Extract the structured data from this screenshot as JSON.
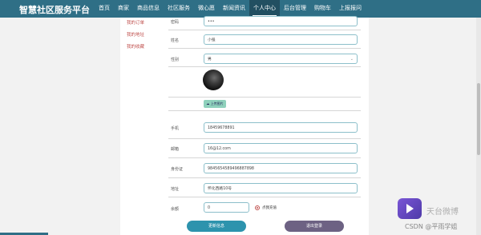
{
  "header": {
    "brand": "智慧社区服务平台",
    "nav": [
      "首页",
      "商家",
      "商品信息",
      "社区服务",
      "微心愿",
      "新闻资讯",
      "个人中心",
      "后台管理",
      "购物车",
      "上报报问"
    ],
    "active_index": 6
  },
  "sidebar": {
    "items": [
      "我的订单",
      "我的地址",
      "我的收藏"
    ]
  },
  "form": {
    "password": {
      "label": "密码",
      "value": "•••"
    },
    "name": {
      "label": "姓名",
      "value": "小强"
    },
    "gender": {
      "label": "性别",
      "value": "男"
    },
    "upload_button": "上传图片",
    "phone": {
      "label": "手机",
      "value": "18459678891"
    },
    "email": {
      "label": "邮箱",
      "value": "16@12.com"
    },
    "id_card": {
      "label": "身份证",
      "value": "9845654589496887898"
    },
    "address": {
      "label": "地址",
      "value": "怀化西路10号"
    },
    "balance": {
      "label": "余额",
      "value": "0",
      "recharge_label": "点我充值"
    }
  },
  "buttons": {
    "update": "更新信息",
    "logout": "退出登录"
  },
  "watermark": {
    "text": "天台微博",
    "csdn": "CSDN @平雨学姐"
  },
  "colors": {
    "topbar": "#2f6f86",
    "accent": "#2d93ad",
    "logout": "#6d6283",
    "sidebar_text": "#c0504d"
  }
}
